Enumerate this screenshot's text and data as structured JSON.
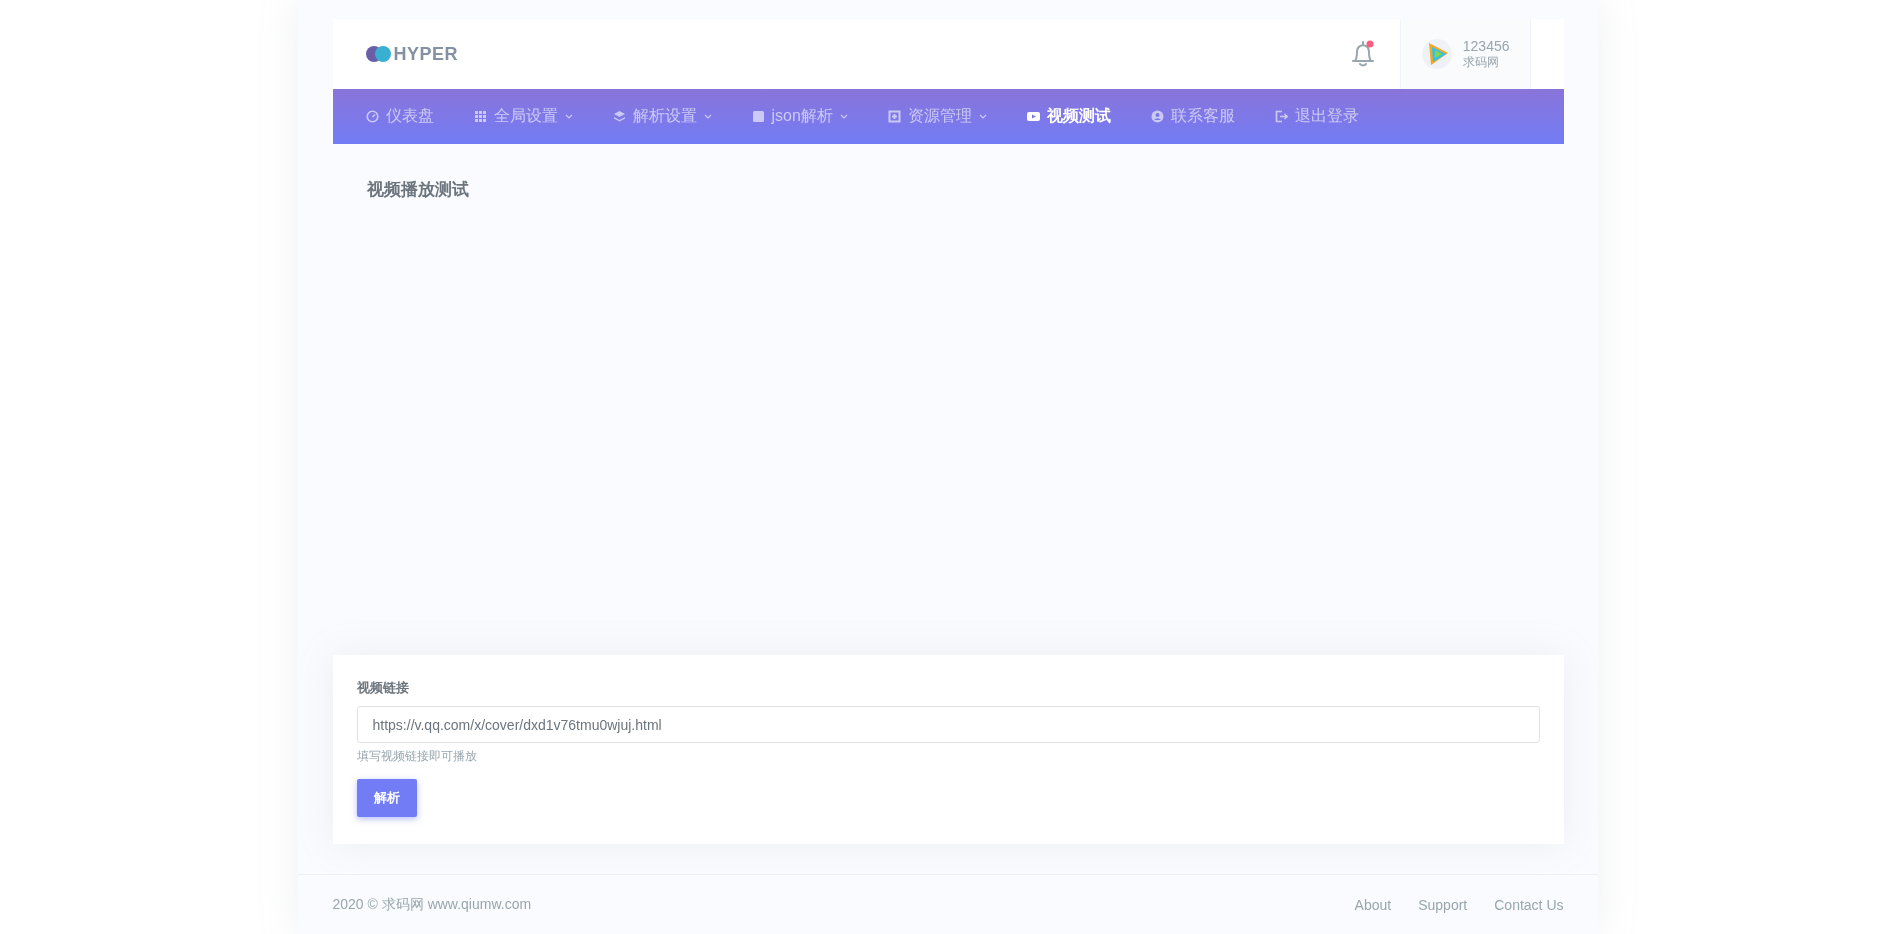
{
  "header": {
    "logo": "HYPER",
    "notification": {
      "unread": true
    },
    "user": {
      "name": "123456",
      "subtitle": "求码网"
    }
  },
  "nav": [
    {
      "label": "仪表盘",
      "has_menu": false,
      "selected": false
    },
    {
      "label": "全局设置",
      "has_menu": true,
      "selected": false
    },
    {
      "label": "解析设置",
      "has_menu": true,
      "selected": false
    },
    {
      "label": "json解析",
      "has_menu": true,
      "selected": false
    },
    {
      "label": "资源管理",
      "has_menu": true,
      "selected": false
    },
    {
      "label": "视频测试",
      "has_menu": false,
      "selected": true
    },
    {
      "label": "联系客服",
      "has_menu": false,
      "selected": false
    },
    {
      "label": "退出登录",
      "has_menu": false,
      "selected": false
    }
  ],
  "page_title": "视频播放测试",
  "form": {
    "label": "视频链接",
    "value": "https://v.qq.com/x/cover/dxd1v76tmu0wjuj.html",
    "help": "填写视频链接即可播放",
    "button": "解析"
  },
  "footer": {
    "copyright": "2020 © 求码网 www.qiumw.com",
    "links": [
      "About",
      "Support",
      "Contact Us"
    ]
  }
}
